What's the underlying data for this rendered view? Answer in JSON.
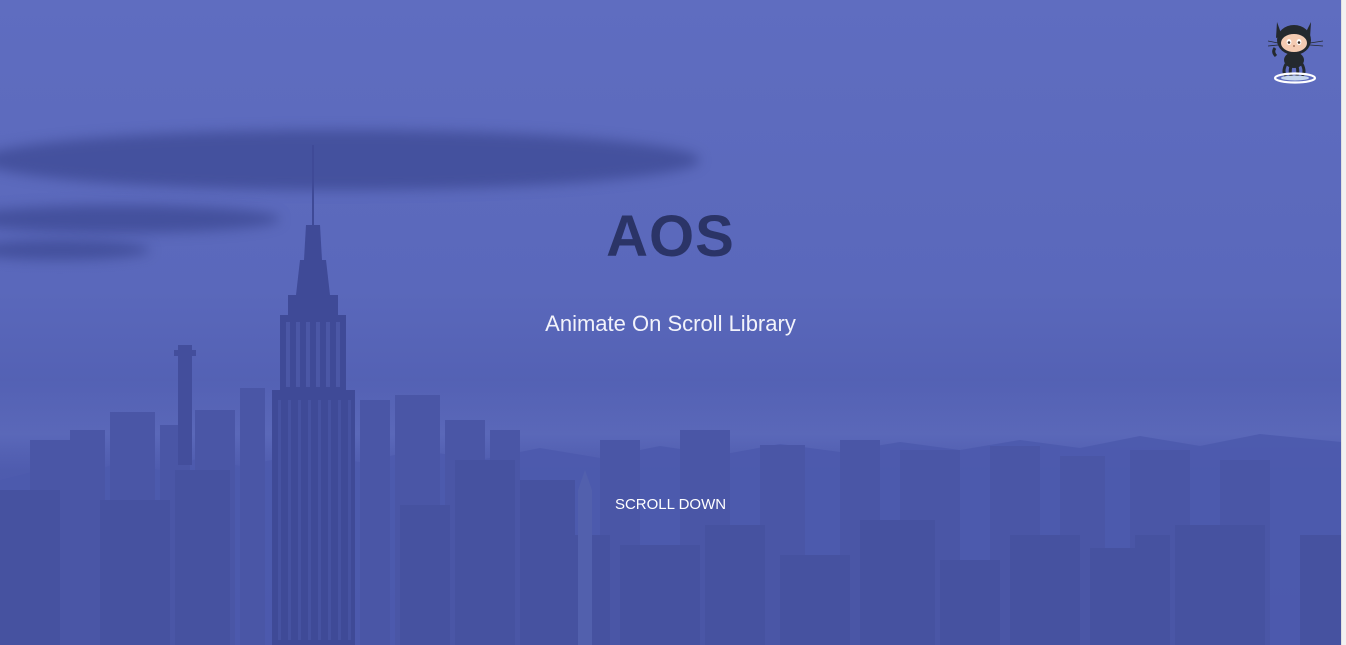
{
  "hero": {
    "title": "AOS",
    "subtitle": "Animate On Scroll Library",
    "scroll_link": "SCROLL DOWN",
    "overlay_color": "#5a68bb"
  },
  "corner": {
    "icon": "github-octocat-icon"
  }
}
